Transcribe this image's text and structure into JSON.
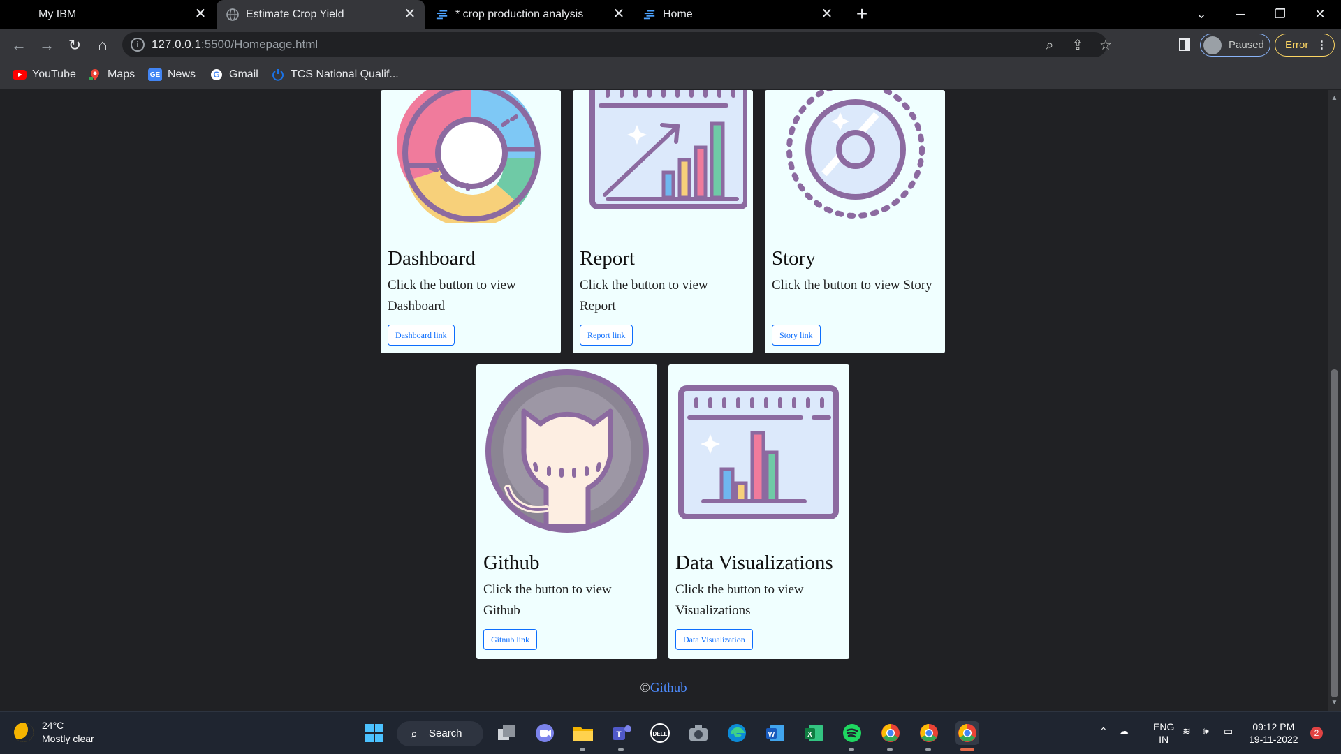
{
  "browser": {
    "tabs": [
      {
        "title": "My IBM",
        "favicon": "ibm-favicon"
      },
      {
        "title": "Estimate Crop Yield",
        "favicon": "globe-icon"
      },
      {
        "title": "* crop production analysis",
        "favicon": "cognos-icon"
      },
      {
        "title": "Home",
        "favicon": "cognos-icon"
      }
    ],
    "close_glyph": "✕",
    "new_tab": "+",
    "address": {
      "host": "127.0.0.1",
      "path": ":5500/Homepage.html"
    },
    "profile_label": "Paused",
    "error_label": "Error",
    "bookmarks": [
      "YouTube",
      "Maps",
      "News",
      "Gmail",
      "TCS National Qualif..."
    ]
  },
  "cards": [
    {
      "title": "Dashboard",
      "text": "Click the button to view Dashboard",
      "button": "Dashboard link",
      "icon": "donut-chart-icon"
    },
    {
      "title": "Report",
      "text": "Click the button to view Report",
      "button": "Report link",
      "icon": "report-chart-icon"
    },
    {
      "title": "Story",
      "text": "Click the button to view Story",
      "button": "Story link",
      "icon": "story-disc-icon"
    },
    {
      "title": "Github",
      "text": "Click the button to view Github",
      "button": "Gitnub link",
      "icon": "github-octocat-icon"
    },
    {
      "title": "Data Visualizations",
      "text": "Click the button to view Visualizations",
      "button": "Data Visualization",
      "icon": "bar-chart-window-icon"
    }
  ],
  "footer": {
    "copyright": "©",
    "link": "Github"
  },
  "taskbar": {
    "weather": {
      "temp": "24°C",
      "condition": "Mostly clear"
    },
    "search_label": "Search",
    "lang": {
      "line1": "ENG",
      "line2": "IN"
    },
    "clock": {
      "time": "09:12 PM",
      "date": "19-11-2022"
    },
    "notifications": "2"
  },
  "colors": {
    "card_bg": "#f0ffff",
    "link_blue": "#0d6efd",
    "page_bg": "#202124"
  }
}
